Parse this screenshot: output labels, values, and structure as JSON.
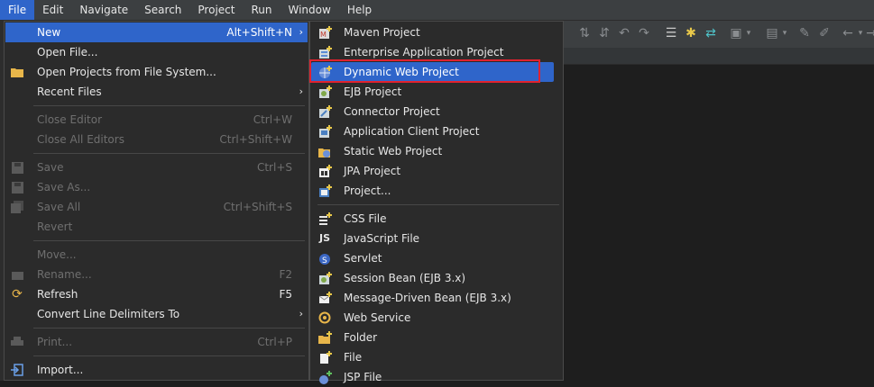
{
  "menubar": {
    "items": [
      {
        "label": "File",
        "active": true
      },
      {
        "label": "Edit"
      },
      {
        "label": "Navigate"
      },
      {
        "label": "Search"
      },
      {
        "label": "Project"
      },
      {
        "label": "Run"
      },
      {
        "label": "Window"
      },
      {
        "label": "Help"
      }
    ]
  },
  "file_menu": {
    "new": {
      "label": "New",
      "shortcut": "Alt+Shift+N"
    },
    "open_file": {
      "label": "Open File..."
    },
    "open_projects": {
      "label": "Open Projects from File System..."
    },
    "recent_files": {
      "label": "Recent Files"
    },
    "close_editor": {
      "label": "Close Editor",
      "shortcut": "Ctrl+W"
    },
    "close_all_editors": {
      "label": "Close All Editors",
      "shortcut": "Ctrl+Shift+W"
    },
    "save": {
      "label": "Save",
      "shortcut": "Ctrl+S"
    },
    "save_as": {
      "label": "Save As..."
    },
    "save_all": {
      "label": "Save All",
      "shortcut": "Ctrl+Shift+S"
    },
    "revert": {
      "label": "Revert"
    },
    "move": {
      "label": "Move..."
    },
    "rename": {
      "label": "Rename...",
      "shortcut": "F2"
    },
    "refresh": {
      "label": "Refresh",
      "shortcut": "F5"
    },
    "convert_line_delimiters": {
      "label": "Convert Line Delimiters To"
    },
    "print": {
      "label": "Print...",
      "shortcut": "Ctrl+P"
    },
    "import": {
      "label": "Import..."
    }
  },
  "new_menu": {
    "maven_project": "Maven Project",
    "enterprise_app_project": "Enterprise Application Project",
    "dynamic_web_project": "Dynamic Web Project",
    "ejb_project": "EJB Project",
    "connector_project": "Connector Project",
    "app_client_project": "Application Client Project",
    "static_web_project": "Static Web Project",
    "jpa_project": "JPA Project",
    "project": "Project...",
    "css_file": "CSS File",
    "javascript_file": "JavaScript File",
    "servlet": "Servlet",
    "session_bean": "Session Bean (EJB 3.x)",
    "message_driven_bean": "Message-Driven Bean (EJB 3.x)",
    "web_service": "Web Service",
    "folder": "Folder",
    "file": "File",
    "jsp_file": "JSP File"
  },
  "colors": {
    "highlight": "#2f65ca",
    "annotation_box": "#e0222f",
    "menu_bg": "#2b2b2b"
  }
}
